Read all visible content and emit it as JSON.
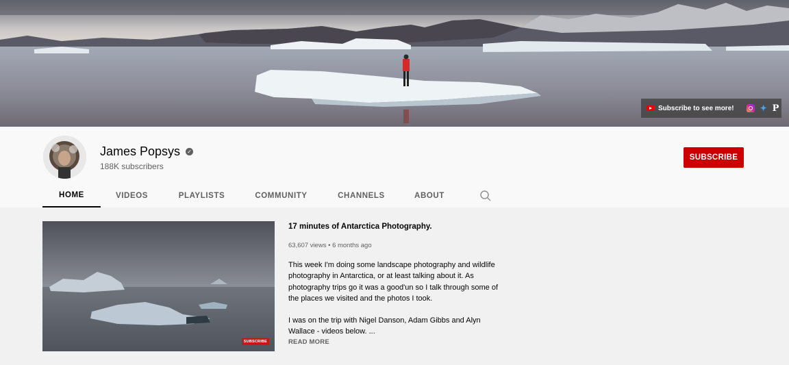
{
  "banner": {
    "promo_text": "Subscribe to see more!",
    "icons": [
      "youtube-icon",
      "instagram-icon",
      "twitter-icon",
      "popsys-logo-icon"
    ]
  },
  "channel": {
    "name": "James Popsys",
    "subscribers": "188K subscribers",
    "subscribe_label": "SUBSCRIBE"
  },
  "tabs": [
    {
      "label": "HOME",
      "active": true
    },
    {
      "label": "VIDEOS",
      "active": false
    },
    {
      "label": "PLAYLISTS",
      "active": false
    },
    {
      "label": "COMMUNITY",
      "active": false
    },
    {
      "label": "CHANNELS",
      "active": false
    },
    {
      "label": "ABOUT",
      "active": false
    }
  ],
  "featured_video": {
    "title": "17 minutes of Antarctica Photography.",
    "views": "63,607 views",
    "age": "6 months ago",
    "description_p1": "This week I'm doing some landscape photography and wildlife photography in Antarctica, or at least talking about it. As photography trips go it was a good'un so I talk through some of the places we visited and the photos I took.",
    "description_p2": "I was on the trip with Nigel Danson, Adam Gibbs and Alyn Wallace - videos below. ...",
    "read_more": "READ MORE",
    "thumbnail_badge": "SUBSCRIBE"
  },
  "colors": {
    "accent": "#cc0000",
    "header_bg": "#f9f9f9",
    "content_bg": "#f1f1f1"
  }
}
